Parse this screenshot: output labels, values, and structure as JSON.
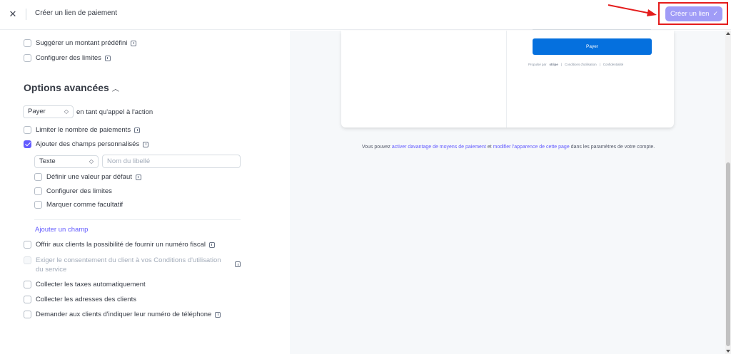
{
  "header": {
    "close_icon": "close-icon",
    "title": "Créer un lien de paiement",
    "create_button": "Créer un lien",
    "create_button_color": "#a09cf7"
  },
  "options": {
    "suggest_amount": "Suggérer un montant prédéfini",
    "configure_limits": "Configurer des limites",
    "advanced_heading": "Options avancées",
    "cta_select_value": "Payer",
    "cta_suffix": "en tant qu'appel à l'action",
    "limit_payments": "Limiter le nombre de paiements",
    "custom_fields": "Ajouter des champs personnalisés",
    "field_type_value": "Texte",
    "label_placeholder": "Nom du libellé",
    "default_value": "Définir une valeur par défaut",
    "field_limits": "Configurer des limites",
    "optional": "Marquer comme facultatif",
    "add_field_link": "Ajouter un champ",
    "tax_id": "Offrir aux clients la possibilité de fournir un numéro fiscal",
    "terms_line1": "Exiger le consentement du client à vos Conditions d'utilisation",
    "terms_line2": "du service",
    "auto_tax": "Collecter les taxes automatiquement",
    "addresses": "Collecter les adresses des clients",
    "phone": "Demander aux clients d'indiquer leur numéro de téléphone",
    "accent_color": "#635bff"
  },
  "preview": {
    "pay_button": "Payer",
    "powered_by": "Propulsé par",
    "stripe": "stripe",
    "terms": "Conditions d'utilisation",
    "privacy": "Confidentialité",
    "footnote_1": "Vous pouvez",
    "footnote_link1": "activer davantage de moyens de paiement",
    "footnote_2": "et",
    "footnote_link2": "modifier l'apparence de cette page",
    "footnote_3": "dans les paramètres de votre compte."
  }
}
